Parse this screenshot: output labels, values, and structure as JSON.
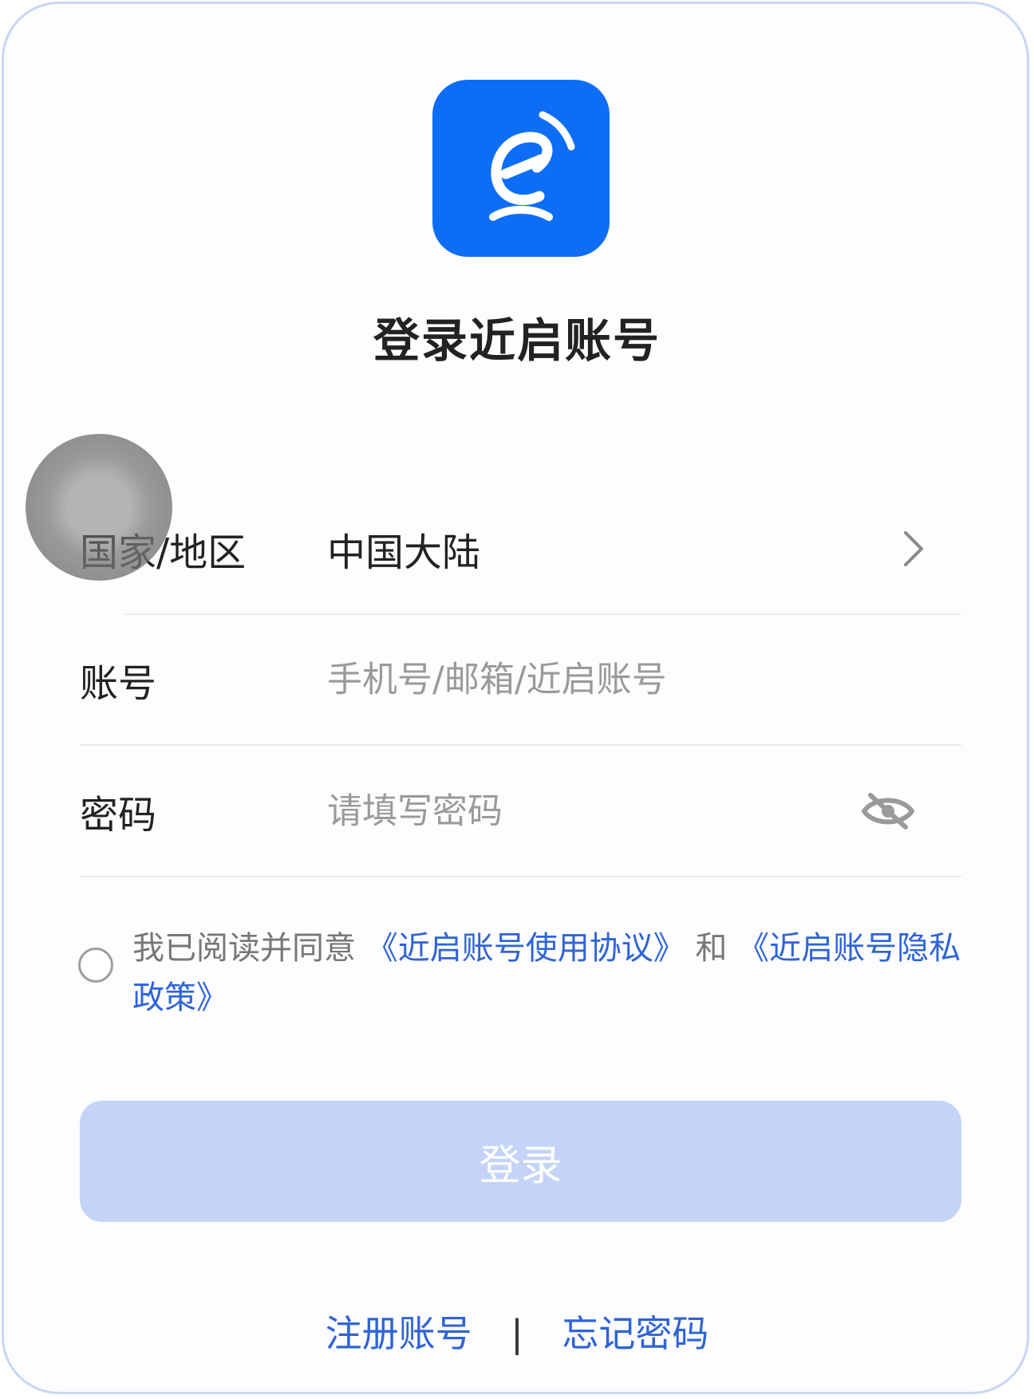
{
  "app": {
    "title": "登录近启账号",
    "logo_icon": "e-camera-logo-icon",
    "brand_color": "#0d6ef5"
  },
  "form": {
    "region": {
      "label": "国家/地区",
      "value": "中国大陆",
      "icon": "chevron-right-icon"
    },
    "account": {
      "label": "账号",
      "placeholder": "手机号/邮箱/近启账号"
    },
    "password": {
      "label": "密码",
      "placeholder": "请填写密码",
      "icon": "eye-off-icon"
    }
  },
  "agreement": {
    "checked": false,
    "prefix": "我已阅读并同意",
    "terms_link": "《近启账号使用协议》",
    "conjunction": "和",
    "privacy_link": "《近启账号隐私政策》"
  },
  "login_button": {
    "label": "登录",
    "enabled": false,
    "color": "#c4d4f8"
  },
  "footer": {
    "register_label": "注册账号",
    "separator": "|",
    "forgot_label": "忘记密码",
    "link_color": "#2f64d8"
  }
}
